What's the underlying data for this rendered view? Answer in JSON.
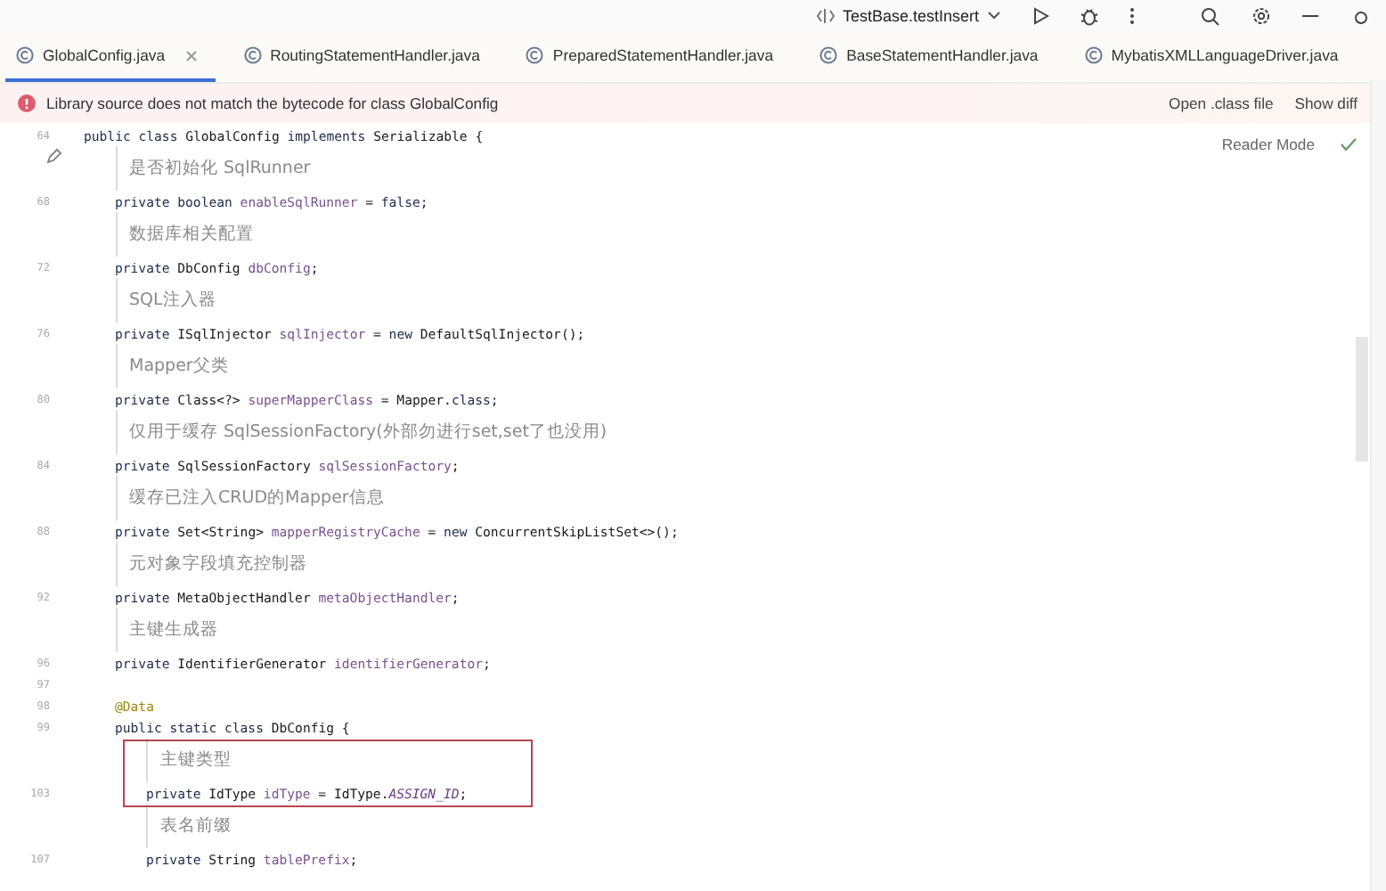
{
  "top_bar": {
    "run_config": "TestBase.testInsert"
  },
  "tabs": [
    {
      "label": "GlobalConfig.java",
      "selected": true
    },
    {
      "label": "RoutingStatementHandler.java",
      "selected": false
    },
    {
      "label": "PreparedStatementHandler.java",
      "selected": false
    },
    {
      "label": "BaseStatementHandler.java",
      "selected": false
    },
    {
      "label": "MybatisXMLLanguageDriver.java",
      "selected": false
    }
  ],
  "banner": {
    "message": "Library source does not match the bytecode for class GlobalConfig",
    "actions": [
      "Open .class file",
      "Show diff"
    ]
  },
  "editor": {
    "reader_mode": "Reader Mode",
    "lines": [
      {
        "kind": "code",
        "number": "64",
        "tokens": [
          {
            "text": "public class ",
            "kind": "keyword"
          },
          {
            "text": "GlobalConfig ",
            "kind": "plain"
          },
          {
            "text": "implements ",
            "kind": "keyword"
          },
          {
            "text": "Serializable {",
            "kind": "plain"
          }
        ],
        "children": [
          {
            "kind": "doc",
            "text": "是否初始化 SqlRunner"
          },
          {
            "kind": "code",
            "number": "68",
            "tokens": [
              {
                "text": "private boolean ",
                "kind": "keyword"
              },
              {
                "text": "enableSqlRunner",
                "kind": "field"
              },
              {
                "text": " = ",
                "kind": "plain"
              },
              {
                "text": "false",
                "kind": "keyword"
              },
              {
                "text": ";",
                "kind": "plain"
              }
            ]
          },
          {
            "kind": "doc",
            "text": "数据库相关配置"
          },
          {
            "kind": "code",
            "number": "72",
            "tokens": [
              {
                "text": "private ",
                "kind": "keyword"
              },
              {
                "text": "DbConfig ",
                "kind": "plain"
              },
              {
                "text": "dbConfig",
                "kind": "field"
              },
              {
                "text": ";",
                "kind": "plain"
              }
            ]
          },
          {
            "kind": "doc",
            "text": "SQL注入器"
          },
          {
            "kind": "code",
            "number": "76",
            "tokens": [
              {
                "text": "private ",
                "kind": "keyword"
              },
              {
                "text": "ISqlInjector ",
                "kind": "plain"
              },
              {
                "text": "sqlInjector",
                "kind": "field"
              },
              {
                "text": " = ",
                "kind": "plain"
              },
              {
                "text": "new ",
                "kind": "keyword"
              },
              {
                "text": "DefaultSqlInjector();",
                "kind": "plain"
              }
            ]
          },
          {
            "kind": "doc",
            "text": "Mapper父类"
          },
          {
            "kind": "code",
            "number": "80",
            "tokens": [
              {
                "text": "private ",
                "kind": "keyword"
              },
              {
                "text": "Class<?> ",
                "kind": "plain"
              },
              {
                "text": "superMapperClass",
                "kind": "field"
              },
              {
                "text": " = Mapper.",
                "kind": "plain"
              },
              {
                "text": "class",
                "kind": "keyword"
              },
              {
                "text": ";",
                "kind": "plain"
              }
            ]
          },
          {
            "kind": "doc",
            "text": "仅用于缓存 SqlSessionFactory(外部勿进行set,set了也没用)"
          },
          {
            "kind": "code",
            "number": "84",
            "tokens": [
              {
                "text": "private ",
                "kind": "keyword"
              },
              {
                "text": "SqlSessionFactory ",
                "kind": "plain"
              },
              {
                "text": "sqlSessionFactory",
                "kind": "field"
              },
              {
                "text": ";",
                "kind": "plain"
              }
            ]
          },
          {
            "kind": "doc",
            "text": "缓存已注入CRUD的Mapper信息"
          },
          {
            "kind": "code",
            "number": "88",
            "tokens": [
              {
                "text": "private ",
                "kind": "keyword"
              },
              {
                "text": "Set<String> ",
                "kind": "plain"
              },
              {
                "text": "mapperRegistryCache",
                "kind": "field"
              },
              {
                "text": " = ",
                "kind": "plain"
              },
              {
                "text": "new ",
                "kind": "keyword"
              },
              {
                "text": "ConcurrentSkipListSet<>();",
                "kind": "plain"
              }
            ]
          },
          {
            "kind": "doc",
            "text": "元对象字段填充控制器"
          },
          {
            "kind": "code",
            "number": "92",
            "tokens": [
              {
                "text": "private ",
                "kind": "keyword"
              },
              {
                "text": "MetaObjectHandler ",
                "kind": "plain"
              },
              {
                "text": "metaObjectHandler",
                "kind": "field"
              },
              {
                "text": ";",
                "kind": "plain"
              }
            ]
          },
          {
            "kind": "doc",
            "text": "主键生成器"
          },
          {
            "kind": "code",
            "number": "96",
            "tokens": [
              {
                "text": "private ",
                "kind": "keyword"
              },
              {
                "text": "IdentifierGenerator ",
                "kind": "plain"
              },
              {
                "text": "identifierGenerator",
                "kind": "field"
              },
              {
                "text": ";",
                "kind": "plain"
              }
            ]
          },
          {
            "kind": "blank",
            "number": "97"
          },
          {
            "kind": "code",
            "number": "98",
            "tokens": [
              {
                "text": "@Data",
                "kind": "annotation"
              }
            ]
          },
          {
            "kind": "code",
            "number": "99",
            "tokens": [
              {
                "text": "public static class ",
                "kind": "keyword"
              },
              {
                "text": "DbConfig {",
                "kind": "plain"
              }
            ],
            "children": [
              {
                "kind": "box",
                "children": [
                  {
                    "kind": "doc",
                    "text": "主键类型"
                  },
                  {
                    "kind": "code",
                    "number": "103",
                    "tokens": [
                      {
                        "text": "private ",
                        "kind": "keyword"
                      },
                      {
                        "text": "IdType ",
                        "kind": "plain"
                      },
                      {
                        "text": "idType",
                        "kind": "field"
                      },
                      {
                        "text": " = IdType.",
                        "kind": "plain"
                      },
                      {
                        "text": "ASSIGN_ID",
                        "kind": "constant"
                      },
                      {
                        "text": ";",
                        "kind": "plain"
                      }
                    ]
                  }
                ]
              },
              {
                "kind": "doc",
                "text": "表名前缀"
              },
              {
                "kind": "code",
                "number": "107",
                "tokens": [
                  {
                    "text": "private ",
                    "kind": "keyword"
                  },
                  {
                    "text": "String ",
                    "kind": "plain"
                  },
                  {
                    "text": "tablePrefix",
                    "kind": "field"
                  },
                  {
                    "text": ";",
                    "kind": "plain"
                  }
                ]
              }
            ]
          }
        ]
      }
    ]
  }
}
